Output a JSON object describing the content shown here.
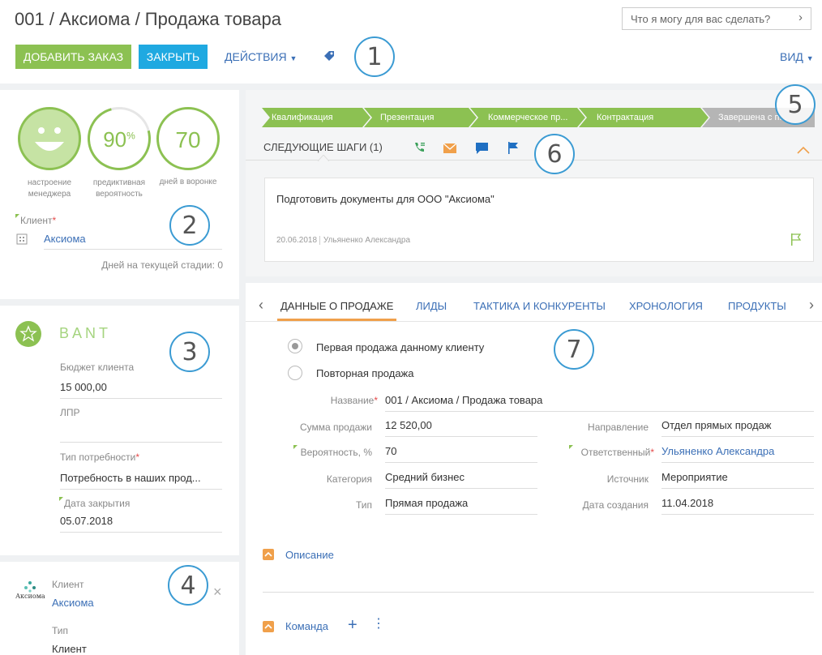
{
  "header": {
    "title": "001 / Аксиома / Продажа товара",
    "search_placeholder": "Что я могу для вас сделать?",
    "add_order": "Добавить заказ",
    "close": "Закрыть",
    "actions": "Действия",
    "view": "Вид"
  },
  "callouts": [
    "1",
    "2",
    "3",
    "4",
    "5",
    "6",
    "7"
  ],
  "metrics": {
    "mood_label": "настроение менеджера",
    "prob_value": "90",
    "prob_suffix": "%",
    "prob_label": "предиктивная вероятность",
    "days_value": "70",
    "days_label": "дней в воронке"
  },
  "client_block": {
    "label": "Клиент",
    "value": "Аксиома",
    "days_stage_label": "Дней на текущей стадии:",
    "days_stage_value": "0"
  },
  "bant": {
    "title": "BANT",
    "budget_label": "Бюджет клиента",
    "budget_value": "15 000,00",
    "lpr_label": "ЛПР",
    "lpr_value": "",
    "need_label": "Тип потребности",
    "need_value": "Потребность в наших прод...",
    "close_date_label": "Дата закрытия",
    "close_date_value": "05.07.2018"
  },
  "client_card": {
    "logo_text": "Аксиома",
    "client_label": "Клиент",
    "client_value": "Аксиома",
    "type_label": "Тип",
    "type_value": "Клиент"
  },
  "stages": [
    "Квалификация",
    "Презентация",
    "Коммерческое пр...",
    "Контрактация",
    "Завершена с п..."
  ],
  "next_steps": {
    "title": "СЛЕДУЮЩИЕ ШАГИ (1)",
    "task_text": "Подготовить документы для ООО \"Аксиома\"",
    "task_date": "20.06.2018",
    "task_owner": "Ульяненко Александра"
  },
  "tabs": [
    "ДАННЫЕ О ПРОДАЖЕ",
    "ЛИДЫ",
    "ТАКТИКА И КОНКУРЕНТЫ",
    "ХРОНОЛОГИЯ",
    "ПРОДУКТЫ"
  ],
  "sale": {
    "radio_first": "Первая продажа данному клиенту",
    "radio_repeat": "Повторная продажа",
    "name_label": "Название",
    "name_value": "001 / Аксиома / Продажа товара",
    "amount_label": "Сумма продажи",
    "amount_value": "12 520,00",
    "prob_label": "Вероятность, %",
    "prob_value": "70",
    "category_label": "Категория",
    "category_value": "Средний бизнес",
    "type_label": "Тип",
    "type_value": "Прямая продажа",
    "direction_label": "Направление",
    "direction_value": "Отдел прямых продаж",
    "owner_label": "Ответственный",
    "owner_value": "Ульяненко Александра",
    "source_label": "Источник",
    "source_value": "Мероприятие",
    "created_label": "Дата создания",
    "created_value": "11.04.2018"
  },
  "sections": {
    "description": "Описание",
    "team": "Команда"
  },
  "colors": {
    "green": "#8cc152",
    "blue_btn": "#1fa9e1",
    "link": "#3b6fb6",
    "callout": "#3b9bd3",
    "orange": "#f0a04b"
  }
}
